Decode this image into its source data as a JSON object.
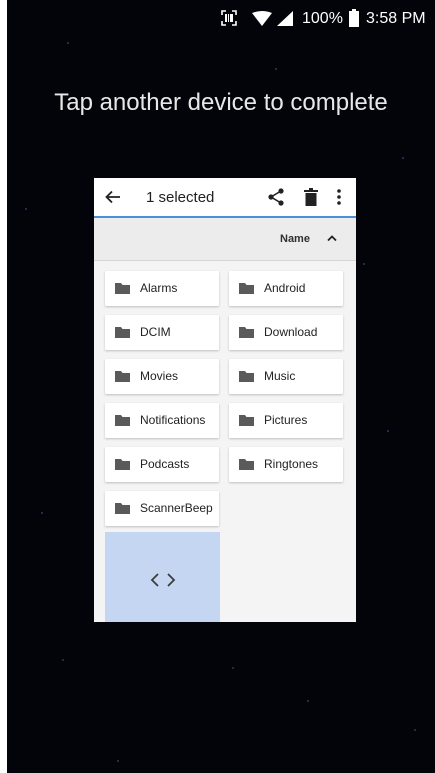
{
  "status_bar": {
    "battery_percent": "100%",
    "time": "3:58 PM",
    "icons": [
      "scanner-icon",
      "wifi-icon",
      "signal-icon",
      "battery-icon"
    ]
  },
  "headline": "Tap another device to complete",
  "file_manager": {
    "toolbar": {
      "title": "1 selected",
      "icons": [
        "back-arrow-icon",
        "share-icon",
        "delete-icon",
        "more-vert-icon"
      ]
    },
    "sort": {
      "label": "Name",
      "direction_icon": "chevron-up-icon"
    },
    "folders": [
      "Alarms",
      "Android",
      "DCIM",
      "Download",
      "Movies",
      "Music",
      "Notifications",
      "Pictures",
      "Podcasts",
      "Ringtones",
      "ScannerBeep"
    ],
    "selected_item_icon": "code-icon"
  },
  "colors": {
    "background": "#02040a",
    "toolbar_underline": "#4a90d9",
    "selected_tile": "#c5d6f3"
  }
}
